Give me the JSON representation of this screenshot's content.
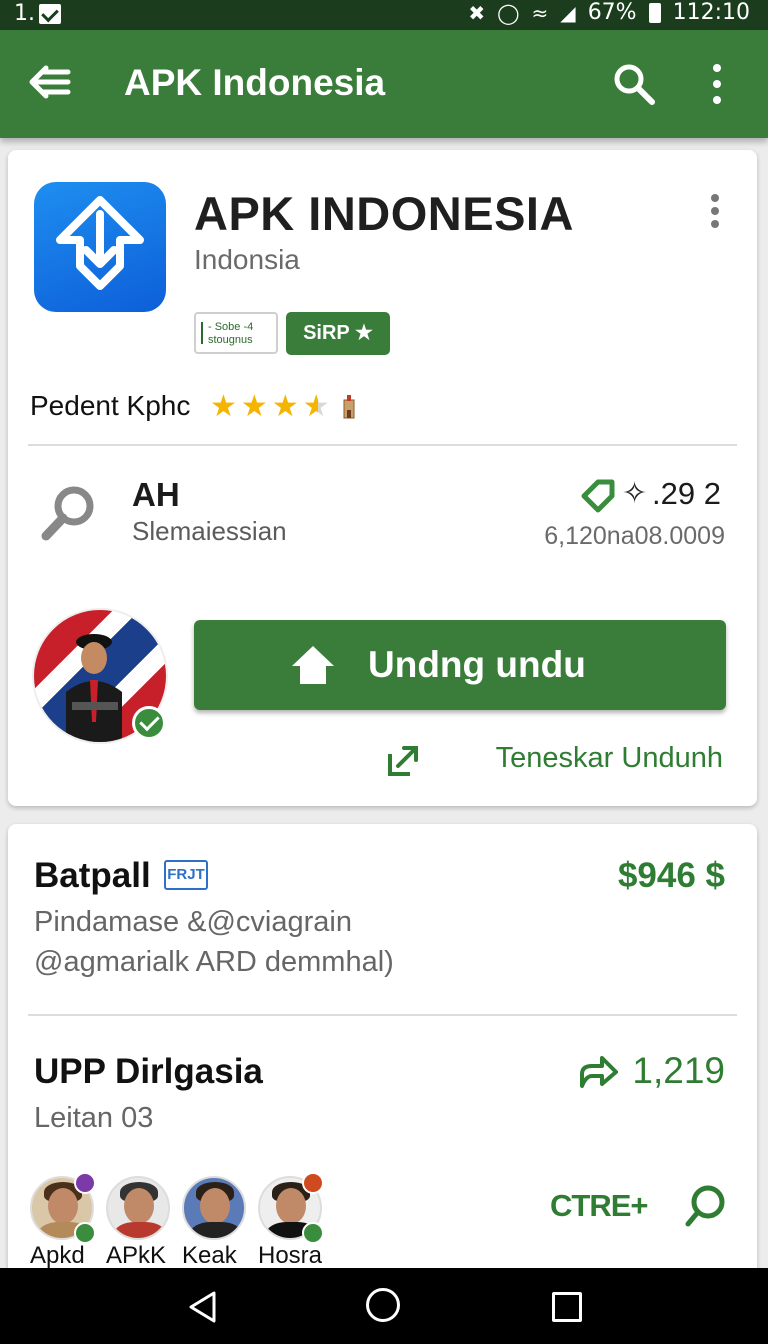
{
  "status_bar": {
    "left_text": "1.",
    "battery": "67%",
    "time": "112:10",
    "icons": [
      "check-box-icon",
      "mute-icon",
      "alarm-icon",
      "wifi-icon",
      "signal-icon",
      "battery-icon"
    ]
  },
  "app_bar": {
    "title": "APK Indonesia",
    "icons": [
      "back-arrow-icon",
      "search-icon",
      "more-vert-icon"
    ]
  },
  "app_card": {
    "name": "APK INDONESIA",
    "subtitle": "Indonsia",
    "badge_outline_line1": "- Sobe -4",
    "badge_outline_line2": "stougnus",
    "badge_filled": "SiRP ★",
    "rating_label": "Pedent Kphc",
    "rating_value": 3.5,
    "rating_max": 5,
    "info_title": "AH",
    "info_subtitle": "Slemaiessian",
    "info_count": ".29 2",
    "info_date": "6,120na08.0009",
    "download_label": "Undng undu",
    "alt_download_label": "Teneskar Undunh",
    "colors": {
      "primary": "#3a7d3b",
      "icon_blue": "#1e8ef0",
      "accent_text": "#2f7d32"
    }
  },
  "list_card": {
    "item1": {
      "title": "Batpall",
      "badge": "FRJT",
      "price": "$946 $",
      "line1": "Pindamase &@cviagrain",
      "line2": "@agmarialk ARD demmhal)"
    },
    "item2": {
      "title": "UPP Dirlgasia",
      "subtitle": "Leitan 03",
      "count": "1,219"
    },
    "users": [
      {
        "name": "Apkd"
      },
      {
        "name": "APkK"
      },
      {
        "name": "Keak"
      },
      {
        "name": "Hosra"
      }
    ],
    "cta_label": "CTRE+"
  },
  "nav_bar": {
    "icons": [
      "nav-back-icon",
      "nav-home-icon",
      "nav-recent-icon"
    ]
  }
}
